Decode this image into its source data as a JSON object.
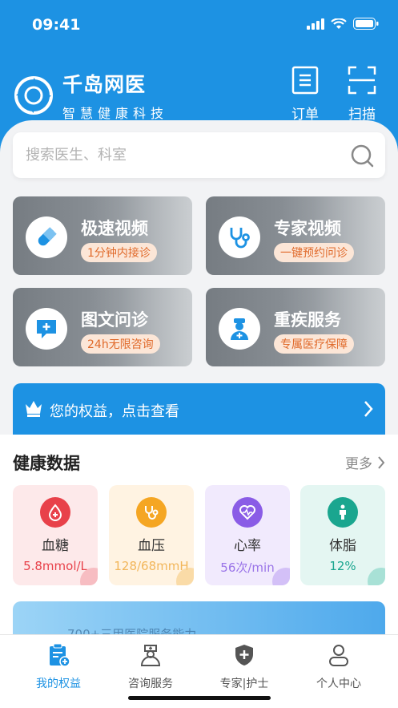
{
  "status_bar": {
    "time": "09:41"
  },
  "brand": {
    "name": "千岛网医",
    "subtitle": "智慧健康科技"
  },
  "header_actions": [
    {
      "label": "订单",
      "icon": "order-icon"
    },
    {
      "label": "扫描",
      "icon": "scan-icon"
    }
  ],
  "search": {
    "placeholder": "搜索医生、科室"
  },
  "services": [
    {
      "title": "极速视频",
      "tag": "1分钟内接诊",
      "icon": "pill-icon"
    },
    {
      "title": "专家视频",
      "tag": "一键预约问诊",
      "icon": "stethoscope-icon"
    },
    {
      "title": "图文问诊",
      "tag": "24h无限咨询",
      "icon": "chat-plus-icon"
    },
    {
      "title": "重疾服务",
      "tag": "专属医疗保障",
      "icon": "doctor-icon"
    }
  ],
  "rights": {
    "text": "您的权益，点击查看"
  },
  "health": {
    "title": "健康数据",
    "more": "更多",
    "metrics": [
      {
        "name": "血糖",
        "value": "5.8mmol/L",
        "color": "#e8414a",
        "bg": "#fde9ea",
        "value_color": "#e8414a"
      },
      {
        "name": "血压",
        "value": "128/68mmH",
        "color": "#f5a623",
        "bg": "#fff3e2",
        "value_color": "#f2b65a"
      },
      {
        "name": "心率",
        "value": "56次/min",
        "color": "#8a5ce6",
        "bg": "#f1eafd",
        "value_color": "#9a74e8"
      },
      {
        "name": "体脂",
        "value": "12%",
        "color": "#1aa68f",
        "bg": "#e4f6f2",
        "value_color": "#1aa68f"
      }
    ]
  },
  "banner": {
    "text": "700+三甲医院服务能力"
  },
  "tabs": [
    {
      "label": "我的权益",
      "icon": "clipboard-plus-icon",
      "active": true
    },
    {
      "label": "咨询服务",
      "icon": "nurse-icon",
      "active": false
    },
    {
      "label": "专家|护士",
      "icon": "shield-plus-icon",
      "active": false
    },
    {
      "label": "个人中心",
      "icon": "user-icon",
      "active": false
    }
  ]
}
